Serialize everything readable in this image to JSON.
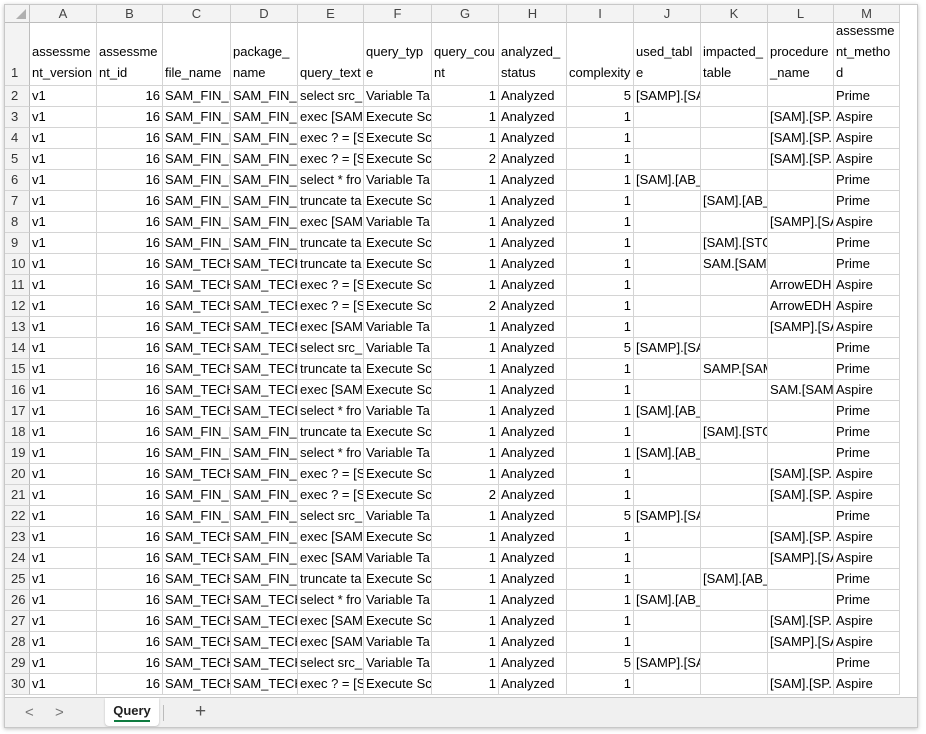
{
  "columns": [
    "A",
    "B",
    "C",
    "D",
    "E",
    "F",
    "G",
    "H",
    "I",
    "J",
    "K",
    "L",
    "M"
  ],
  "headers": [
    "assessment_version",
    "assessment_id",
    "file_name",
    "package_name",
    "query_text",
    "query_type",
    "query_count",
    "analyzed_status",
    "complexity",
    "used_table",
    "impacted_table",
    "procedure_name",
    "assessment_method"
  ],
  "rows": [
    [
      "v1",
      "16",
      "SAM_FIN_I",
      "SAM_FIN_I",
      "select src_",
      "Variable Ta",
      "1",
      "Analyzed",
      "5",
      "[SAMP].[SAM].[LAST_ABRESULT_",
      "",
      "",
      "Prime"
    ],
    [
      "v1",
      "16",
      "SAM_FIN_I",
      "SAM_FIN_I",
      "exec [SAM",
      "Execute Sc",
      "1",
      "Analyzed",
      "1",
      "",
      "",
      "[SAM].[SP.",
      "Aspire"
    ],
    [
      "v1",
      "16",
      "SAM_FIN_I",
      "SAM_FIN_I",
      "exec ? = [S",
      "Execute Sc",
      "1",
      "Analyzed",
      "1",
      "",
      "",
      "[SAM].[SP.",
      "Aspire"
    ],
    [
      "v1",
      "16",
      "SAM_FIN_I",
      "SAM_FIN_I",
      "exec ? = [S",
      "Execute Sc",
      "2",
      "Analyzed",
      "1",
      "",
      "",
      "[SAM].[SP.",
      "Aspire"
    ],
    [
      "v1",
      "16",
      "SAM_FIN_I",
      "SAM_FIN_I",
      "select * fro",
      "Variable Ta",
      "1",
      "Analyzed",
      "1",
      "[SAM].[AB_STG_DIM_PROJECT]",
      "",
      "",
      "Prime"
    ],
    [
      "v1",
      "16",
      "SAM_FIN_I",
      "SAM_FIN_I",
      "truncate ta",
      "Execute Sc",
      "1",
      "Analyzed",
      "1",
      "",
      "[SAM].[AB_STG_DIM_I",
      "",
      "Prime"
    ],
    [
      "v1",
      "16",
      "SAM_FIN_I",
      "SAM_FIN_I",
      "exec [SAM",
      "Variable Ta",
      "1",
      "Analyzed",
      "1",
      "",
      "",
      "[SAMP].[SA",
      "Aspire"
    ],
    [
      "v1",
      "16",
      "SAM_FIN_I",
      "SAM_FIN_I",
      "truncate ta",
      "Execute Sc",
      "1",
      "Analyzed",
      "1",
      "",
      "[SAM].[STG_DIM_PRC",
      "",
      "Prime"
    ],
    [
      "v1",
      "16",
      "SAM_TECH",
      "SAM_TECH",
      "truncate ta",
      "Execute Sc",
      "1",
      "Analyzed",
      "1",
      "",
      "SAM.[SAM].[STG_DIM",
      "",
      "Prime"
    ],
    [
      "v1",
      "16",
      "SAM_TECH",
      "SAM_TECH",
      "exec ? = [S",
      "Execute Sc",
      "1",
      "Analyzed",
      "1",
      "",
      "",
      "ArrowEDH",
      "Aspire"
    ],
    [
      "v1",
      "16",
      "SAM_TECH",
      "SAM_TECH",
      "exec ? = [S",
      "Execute Sc",
      "2",
      "Analyzed",
      "1",
      "",
      "",
      "ArrowEDH",
      "Aspire"
    ],
    [
      "v1",
      "16",
      "SAM_TECH",
      "SAM_TECH",
      "exec [SAM",
      "Variable Ta",
      "1",
      "Analyzed",
      "1",
      "",
      "",
      "[SAMP].[SA",
      "Aspire"
    ],
    [
      "v1",
      "16",
      "SAM_TECH",
      "SAM_TECH",
      "select src_",
      "Variable Ta",
      "1",
      "Analyzed",
      "5",
      "[SAMP].[SAM].[LAST_ABRESULT_",
      "",
      "",
      "Prime"
    ],
    [
      "v1",
      "16",
      "SAM_TECH",
      "SAM_TECH",
      "truncate ta",
      "Execute Sc",
      "1",
      "Analyzed",
      "1",
      "",
      "SAMP.[SAM].[AB_STG",
      "",
      "Prime"
    ],
    [
      "v1",
      "16",
      "SAM_TECH",
      "SAM_TECH",
      "exec [SAM",
      "Execute Sc",
      "1",
      "Analyzed",
      "1",
      "",
      "",
      "SAM.[SAM",
      "Aspire"
    ],
    [
      "v1",
      "16",
      "SAM_TECH",
      "SAM_TECH",
      "select * fro",
      "Variable Ta",
      "1",
      "Analyzed",
      "1",
      "[SAM].[AB_STG_DIM_BASIN]",
      "",
      "",
      "Prime"
    ],
    [
      "v1",
      "16",
      "SAM_FIN_I",
      "SAM_FIN_I",
      "truncate ta",
      "Execute Sc",
      "1",
      "Analyzed",
      "1",
      "",
      "[SAM].[STG_DIM_DNF",
      "",
      "Prime"
    ],
    [
      "v1",
      "16",
      "SAM_FIN_I",
      "SAM_FIN_I",
      "select * fro",
      "Variable Ta",
      "1",
      "Analyzed",
      "1",
      "[SAM].[AB_STG_DIM_DNRM_BOF",
      "",
      "",
      "Prime"
    ],
    [
      "v1",
      "16",
      "SAM_TECH",
      "SAM_FIN_I",
      "exec ? = [S",
      "Execute Sc",
      "1",
      "Analyzed",
      "1",
      "",
      "",
      "[SAM].[SP.",
      "Aspire"
    ],
    [
      "v1",
      "16",
      "SAM_FIN_I",
      "SAM_FIN_I",
      "exec ? = [S",
      "Execute Sc",
      "2",
      "Analyzed",
      "1",
      "",
      "",
      "[SAM].[SP.",
      "Aspire"
    ],
    [
      "v1",
      "16",
      "SAM_FIN_I",
      "SAM_FIN_I",
      "select src_",
      "Variable Ta",
      "1",
      "Analyzed",
      "5",
      "[SAMP].[SAM].[LAST_ABRESULT_",
      "",
      "",
      "Prime"
    ],
    [
      "v1",
      "16",
      "SAM_TECH",
      "SAM_FIN_I",
      "exec [SAM",
      "Execute Sc",
      "1",
      "Analyzed",
      "1",
      "",
      "",
      "[SAM].[SP.",
      "Aspire"
    ],
    [
      "v1",
      "16",
      "SAM_TECH",
      "SAM_FIN_I",
      "exec [SAM",
      "Variable Ta",
      "1",
      "Analyzed",
      "1",
      "",
      "",
      "[SAMP].[SA",
      "Aspire"
    ],
    [
      "v1",
      "16",
      "SAM_TECH",
      "SAM_FIN_I",
      "truncate ta",
      "Execute Sc",
      "1",
      "Analyzed",
      "1",
      "",
      "[SAM].[AB_STG_DIM_I",
      "",
      "Prime"
    ],
    [
      "v1",
      "16",
      "SAM_TECH",
      "SAM_TECH",
      "select * fro",
      "Variable Ta",
      "1",
      "Analyzed",
      "1",
      "[SAM].[AB_STG_DIM_FIELD]",
      "",
      "",
      "Prime"
    ],
    [
      "v1",
      "16",
      "SAM_TECH",
      "SAM_TECH",
      "exec [SAM",
      "Execute Sc",
      "1",
      "Analyzed",
      "1",
      "",
      "",
      "[SAM].[SP.",
      "Aspire"
    ],
    [
      "v1",
      "16",
      "SAM_TECH",
      "SAM_TECH",
      "exec [SAM",
      "Variable Ta",
      "1",
      "Analyzed",
      "1",
      "",
      "",
      "[SAMP].[SA",
      "Aspire"
    ],
    [
      "v1",
      "16",
      "SAM_TECH",
      "SAM_TECH",
      "select src_",
      "Variable Ta",
      "1",
      "Analyzed",
      "5",
      "[SAMP].[SAM].[LAST_ABRESULT_",
      "",
      "",
      "Prime"
    ],
    [
      "v1",
      "16",
      "SAM_TECH",
      "SAM_TECH",
      "exec ? = [S",
      "Execute Sc",
      "1",
      "Analyzed",
      "1",
      "",
      "",
      "[SAM].[SP.",
      "Aspire"
    ]
  ],
  "sheet_tabs": {
    "prev_icon": "<",
    "next_icon": ">",
    "active_tab": "Query",
    "add_icon": "+"
  }
}
